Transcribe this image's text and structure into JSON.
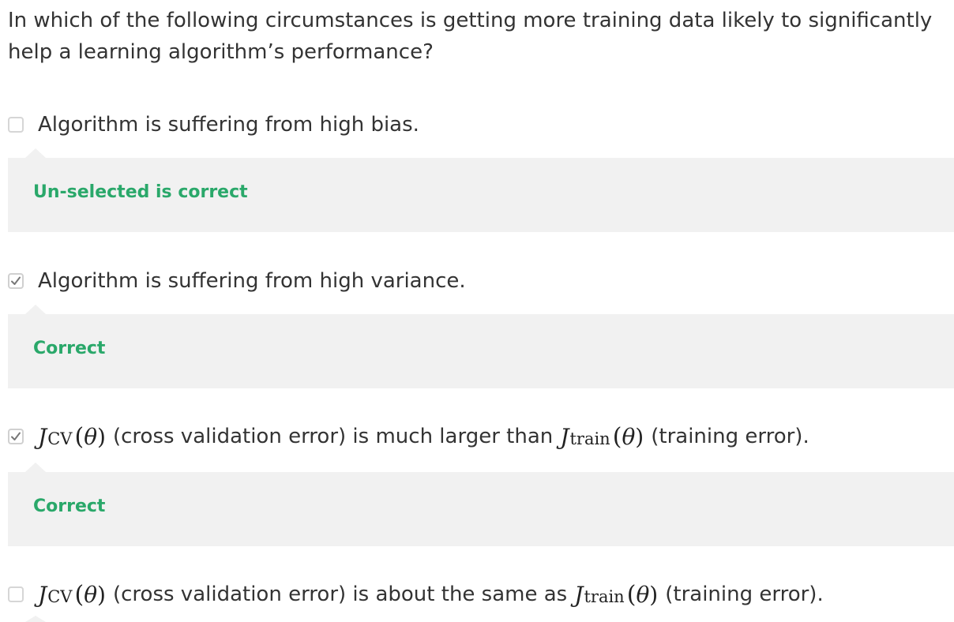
{
  "question": {
    "text": "In which of the following circumstances is getting more training data likely to significantly help a learning algorithm’s performance?"
  },
  "options": [
    {
      "label": "Algorithm is suffering from high bias.",
      "checked": false,
      "feedback": "Un-selected is correct"
    },
    {
      "label": "Algorithm is suffering from high variance.",
      "checked": true,
      "feedback": "Correct"
    },
    {
      "math_a": {
        "var": "J",
        "sub": "CV",
        "arg": "θ"
      },
      "text_1": "(cross validation error) is much larger than",
      "math_b": {
        "var": "J",
        "sub": "train",
        "arg": "θ"
      },
      "text_2": "(training error).",
      "checked": true,
      "feedback": "Correct"
    },
    {
      "math_a": {
        "var": "J",
        "sub": "CV",
        "arg": "θ"
      },
      "text_1": "(cross validation error) is about the same as",
      "math_b": {
        "var": "J",
        "sub": "train",
        "arg": "θ"
      },
      "text_2": "(training error).",
      "checked": false
    }
  ],
  "colors": {
    "correct_green": "#2aa86a",
    "feedback_bg": "#f1f1f1",
    "checkbox_border": "#d6d6d6",
    "text": "#333333"
  },
  "icons": {
    "checked": "checkmark-icon"
  }
}
